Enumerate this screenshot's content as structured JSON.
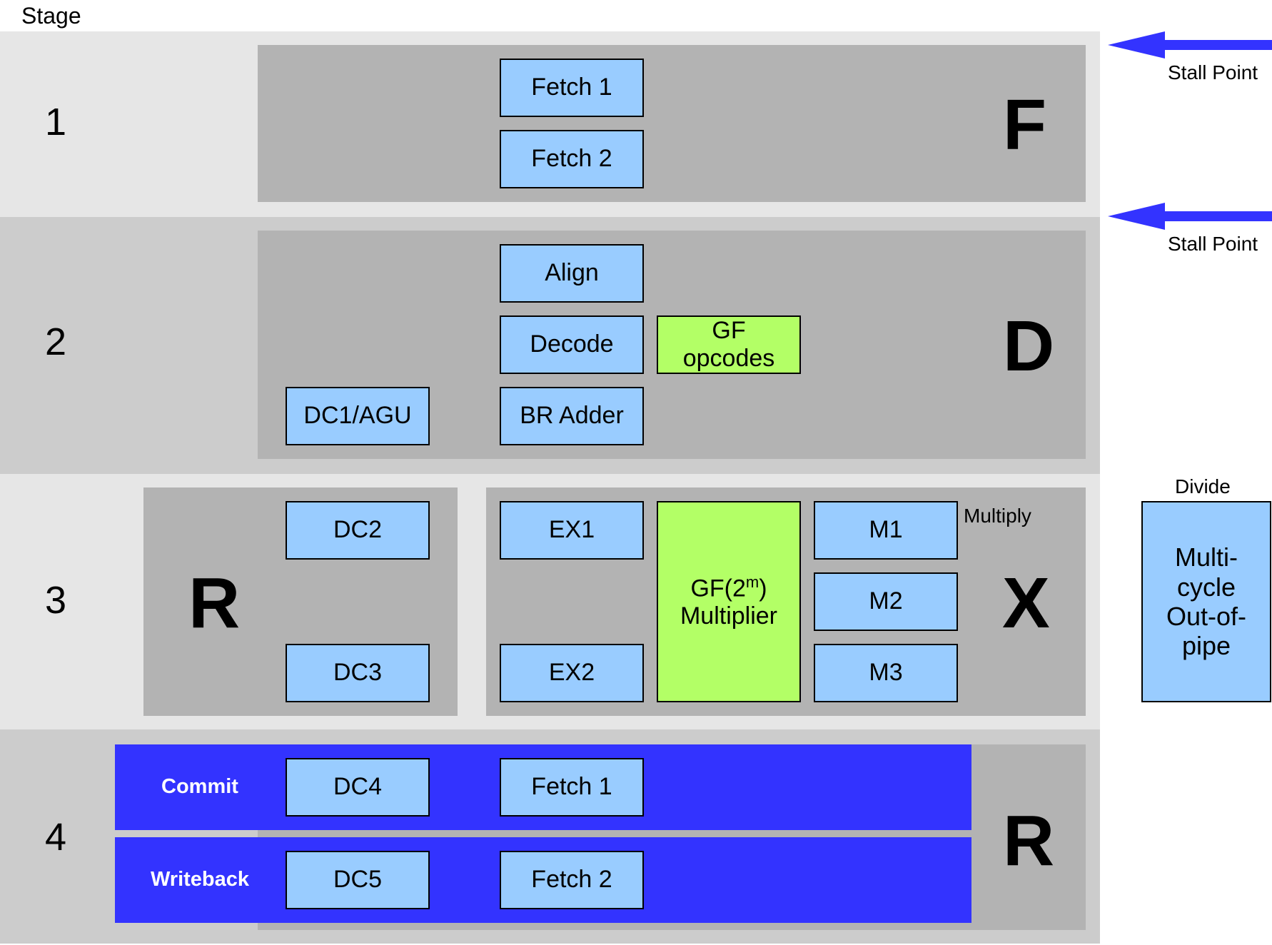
{
  "header": {
    "stage_label": "Stage"
  },
  "stages": [
    {
      "number": "1",
      "unit": "F"
    },
    {
      "number": "2",
      "unit": "D"
    },
    {
      "number": "3",
      "unit_left": "R",
      "unit_right": "X"
    },
    {
      "number": "4",
      "unit": "R"
    }
  ],
  "stall_points": [
    "Stall Point",
    "Stall Point"
  ],
  "stage1": {
    "fetch1": "Fetch 1",
    "fetch2": "Fetch 2"
  },
  "stage2": {
    "align": "Align",
    "decode": "Decode",
    "br_adder": "BR Adder",
    "dc1": "DC1/AGU",
    "gf_opcodes_line1": "GF",
    "gf_opcodes_line2": "opcodes"
  },
  "stage3": {
    "dc2": "DC2",
    "dc3": "DC3",
    "ex1": "EX1",
    "ex2": "EX2",
    "gf_mult_prefix": "GF(2",
    "gf_mult_sup": "m",
    "gf_mult_suffix": ")",
    "gf_mult_line2": "Multiplier",
    "m1": "M1",
    "m2": "M2",
    "m3": "M3",
    "multiply_label": "Multiply"
  },
  "divide": {
    "label": "Divide",
    "lines": [
      "Multi-",
      "cycle",
      "Out-of-",
      "pipe"
    ]
  },
  "stage4": {
    "commit": "Commit",
    "writeback": "Writeback",
    "dc4": "DC4",
    "dc5": "DC5",
    "fetch1": "Fetch 1",
    "fetch2": "Fetch 2"
  },
  "colors": {
    "unit_box": "#99ccff",
    "gf_box": "#b3ff66",
    "band": "#3333ff",
    "panel": "#b3b3b3",
    "arrow": "#3333ff"
  }
}
